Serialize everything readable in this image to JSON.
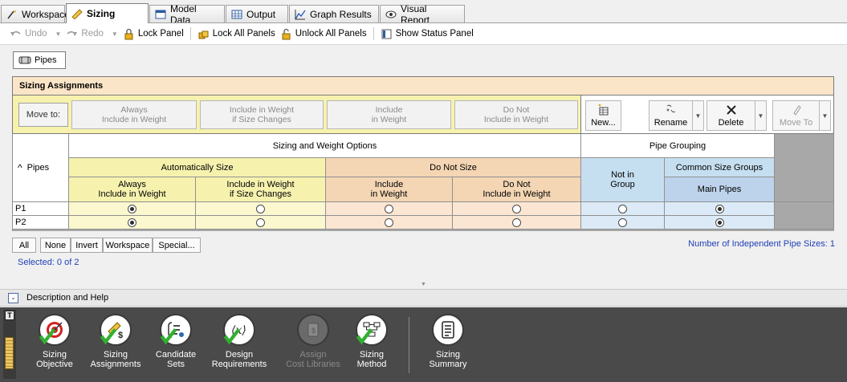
{
  "tabs": [
    {
      "label": "Workspace",
      "icon": "workspace-icon"
    },
    {
      "label": "Sizing",
      "icon": "sizing-icon",
      "active": true
    },
    {
      "label": "Model Data",
      "icon": "model-data-icon"
    },
    {
      "label": "Output",
      "icon": "output-icon"
    },
    {
      "label": "Graph Results",
      "icon": "graph-icon"
    },
    {
      "label": "Visual Report",
      "icon": "visual-report-icon"
    }
  ],
  "toolbar": {
    "undo": "Undo",
    "redo": "Redo",
    "lock_panel": "Lock Panel",
    "lock_all": "Lock All Panels",
    "unlock_all": "Unlock All Panels",
    "show_status": "Show Status Panel"
  },
  "pipes_tab": "Pipes",
  "sizing_assignments": {
    "title": "Sizing Assignments",
    "move_to": "Move to:",
    "move_buttons": [
      {
        "line1": "Always",
        "line2": "Include in Weight"
      },
      {
        "line1": "Include in Weight",
        "line2": "if Size Changes"
      },
      {
        "line1": "Include",
        "line2": "in Weight"
      },
      {
        "line1": "Do Not",
        "line2": "Include in Weight"
      }
    ],
    "group_buttons": {
      "new": "New...",
      "rename": "Rename",
      "delete": "Delete",
      "move_to": "Move To"
    }
  },
  "grid": {
    "pipes_header": "Pipes",
    "sort_indicator": "^",
    "sizing_weight_options": "Sizing and Weight Options",
    "pipe_grouping": "Pipe Grouping",
    "automatically_size": "Automatically Size",
    "do_not_size": "Do Not Size",
    "not_in_group": "Not in Group",
    "common_size_groups": "Common Size Groups",
    "main_pipes": "Main Pipes",
    "col_headers": [
      {
        "line1": "Always",
        "line2": "Include in Weight"
      },
      {
        "line1": "Include in Weight",
        "line2": "if Size Changes"
      },
      {
        "line1": "Include",
        "line2": "in Weight"
      },
      {
        "line1": "Do Not",
        "line2": "Include in Weight"
      }
    ],
    "rows": [
      {
        "name": "P1",
        "weight_option": 0,
        "group": "Main Pipes"
      },
      {
        "name": "P2",
        "weight_option": 0,
        "group": "Main Pipes"
      }
    ]
  },
  "selection": {
    "buttons": [
      "All",
      "None",
      "Invert",
      "Workspace",
      "Special..."
    ],
    "selected_text": "Selected: 0 of 2",
    "independent_sizes": "Number of Independent Pipe Sizes: 1"
  },
  "description": "Description and Help",
  "bottom_tools": [
    {
      "label1": "Sizing",
      "label2": "Objective",
      "icon": "target-icon",
      "enabled": true
    },
    {
      "label1": "Sizing",
      "label2": "Assignments",
      "icon": "ruler-dollar-icon",
      "enabled": true
    },
    {
      "label1": "Candidate",
      "label2": "Sets",
      "icon": "list-icon",
      "enabled": true
    },
    {
      "label1": "Design",
      "label2": "Requirements",
      "icon": "variable-icon",
      "enabled": true
    },
    {
      "label1": "Assign",
      "label2": "Cost Libraries",
      "icon": "cost-library-icon",
      "enabled": false
    },
    {
      "label1": "Sizing",
      "label2": "Method",
      "icon": "flowchart-icon",
      "enabled": true
    },
    {
      "label1": "Sizing",
      "label2": "Summary",
      "icon": "summary-icon",
      "enabled": true
    }
  ],
  "colors": {
    "sa_header": "#fbe5c8",
    "auto_size": "#f6f2ae",
    "do_not_size": "#f4d6b4",
    "grouping": "#c6dff0",
    "bottom_panel": "#4a4a4a",
    "link_blue": "#1f3fb6"
  }
}
